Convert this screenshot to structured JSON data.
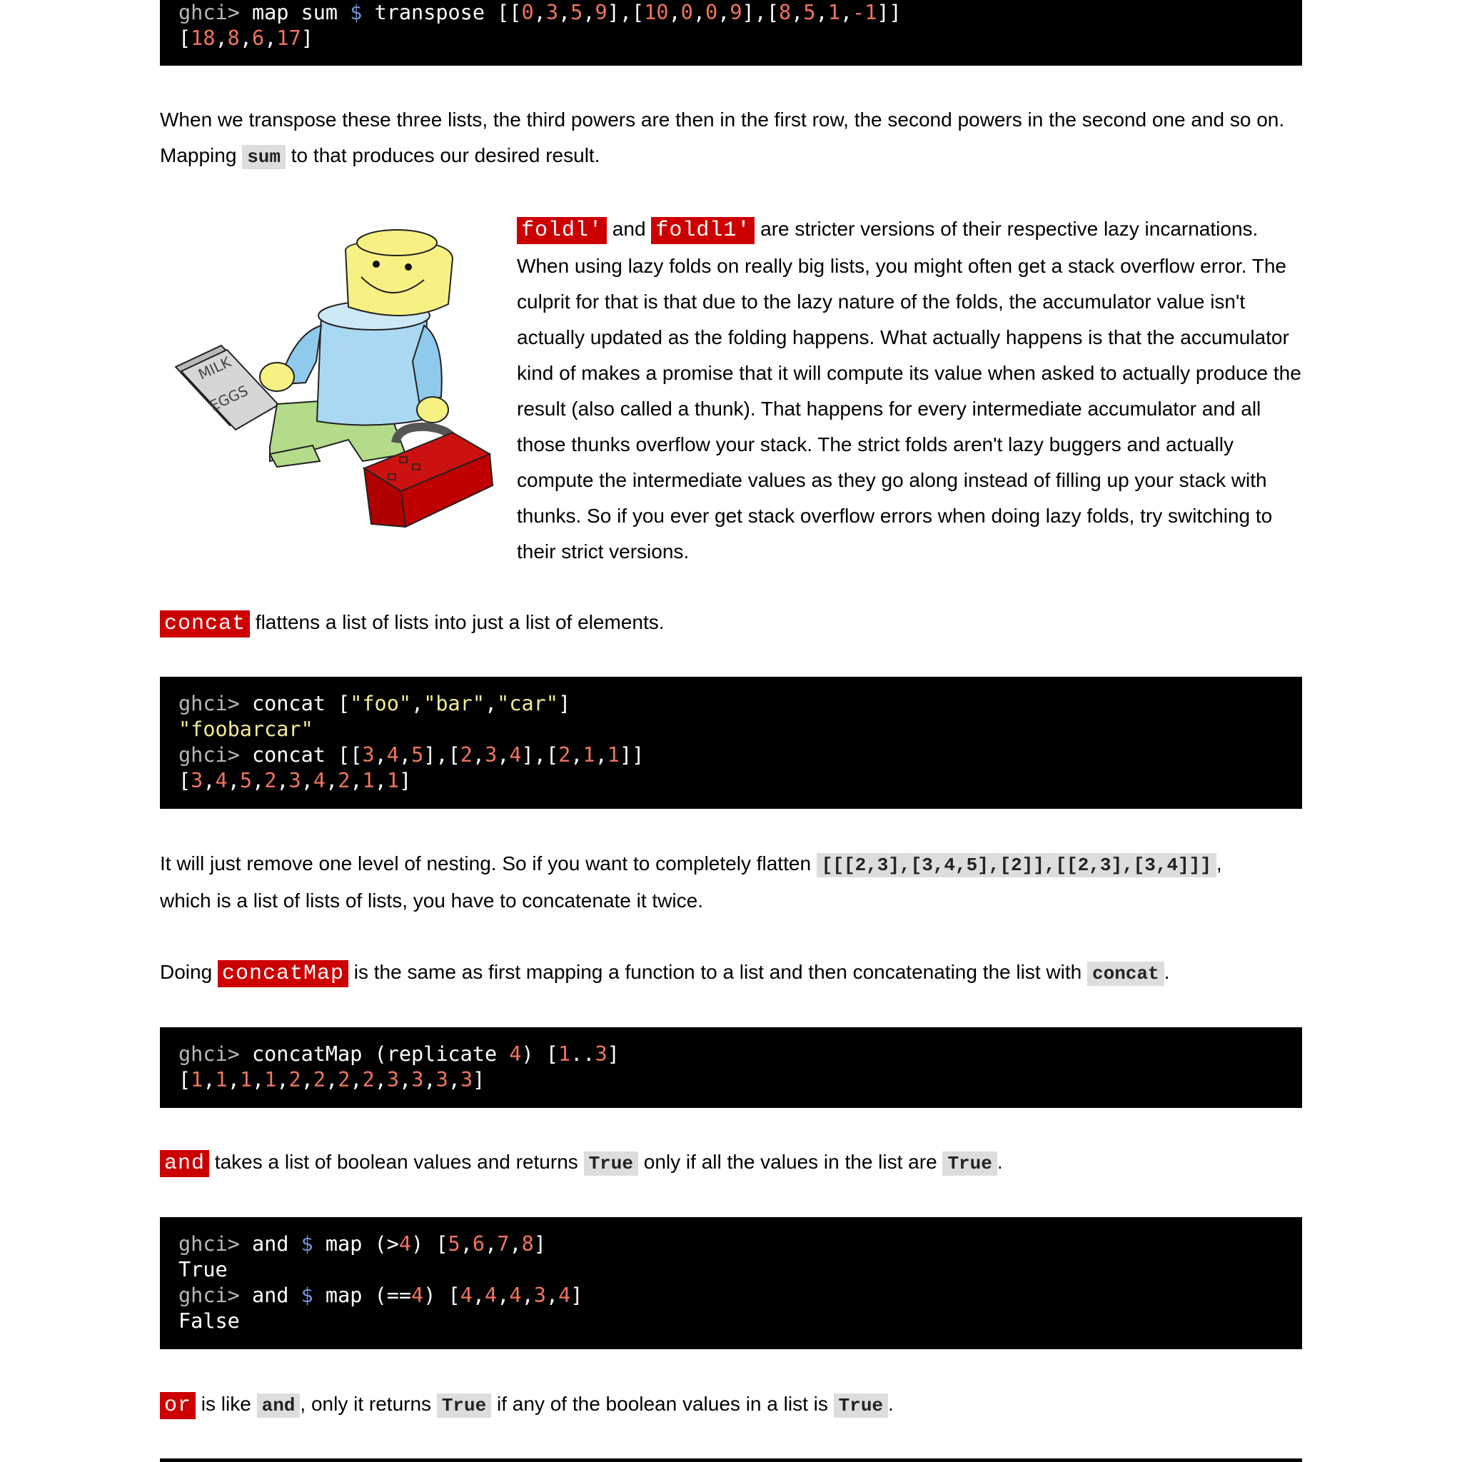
{
  "code_block_1": {
    "lines": [
      [
        {
          "c": "pr",
          "t": "ghci> "
        },
        {
          "c": "",
          "t": "map sum "
        },
        {
          "c": "op",
          "t": "$"
        },
        {
          "c": "",
          "t": " transpose [["
        },
        {
          "c": "n",
          "t": "0"
        },
        {
          "c": "",
          "t": ","
        },
        {
          "c": "n",
          "t": "3"
        },
        {
          "c": "",
          "t": ","
        },
        {
          "c": "n",
          "t": "5"
        },
        {
          "c": "",
          "t": ","
        },
        {
          "c": "n",
          "t": "9"
        },
        {
          "c": "",
          "t": "],["
        },
        {
          "c": "n",
          "t": "10"
        },
        {
          "c": "",
          "t": ","
        },
        {
          "c": "n",
          "t": "0"
        },
        {
          "c": "",
          "t": ","
        },
        {
          "c": "n",
          "t": "0"
        },
        {
          "c": "",
          "t": ","
        },
        {
          "c": "n",
          "t": "9"
        },
        {
          "c": "",
          "t": "],["
        },
        {
          "c": "n",
          "t": "8"
        },
        {
          "c": "",
          "t": ","
        },
        {
          "c": "n",
          "t": "5"
        },
        {
          "c": "",
          "t": ","
        },
        {
          "c": "n",
          "t": "1"
        },
        {
          "c": "",
          "t": ","
        },
        {
          "c": "n",
          "t": "-1"
        },
        {
          "c": "",
          "t": "]]"
        }
      ],
      [
        {
          "c": "",
          "t": "["
        },
        {
          "c": "n",
          "t": "18"
        },
        {
          "c": "",
          "t": ","
        },
        {
          "c": "n",
          "t": "8"
        },
        {
          "c": "",
          "t": ","
        },
        {
          "c": "n",
          "t": "6"
        },
        {
          "c": "",
          "t": ","
        },
        {
          "c": "n",
          "t": "17"
        },
        {
          "c": "",
          "t": "]"
        }
      ]
    ]
  },
  "para_transpose": {
    "line1": "When we transpose these three lists, the third powers are then in the first row, the second powers in the second one and so on.",
    "line2_pre": "Mapping ",
    "line2_code": "sum",
    "line2_post": " to that produces our desired result."
  },
  "foldl_section": {
    "fn1": "foldl'",
    "and_text": " and ",
    "fn2": "foldl1'",
    "lines": [
      " are stricter versions of their respective lazy incarnations.",
      "When using lazy folds on really big lists, you might often get a stack overflow error. The",
      "culprit for that is that due to the lazy nature of the folds, the accumulator value isn't",
      "actually updated as the folding happens. What actually happens is that the accumulator",
      "kind of makes a promise that it will compute its value when asked to actually produce the",
      "result (also called a thunk). That happens for every intermediate accumulator and all",
      "those thunks overflow your stack. The strict folds aren't lazy buggers and actually",
      "compute the intermediate values as they go along instead of filling up your stack with",
      "thunks. So if you ever get stack overflow errors when doing lazy folds, try switching to",
      "their strict versions."
    ],
    "illustration": {
      "icon": "lego-man-with-toolbox-icon",
      "note_text_1": "MILK",
      "note_text_2": "EGGS"
    }
  },
  "para_concat": {
    "fn": "concat",
    "text": " flattens a list of lists into just a list of elements."
  },
  "code_block_2": {
    "lines": [
      [
        {
          "c": "pr",
          "t": "ghci> "
        },
        {
          "c": "",
          "t": "concat ["
        },
        {
          "c": "s",
          "t": "\"foo\""
        },
        {
          "c": "",
          "t": ","
        },
        {
          "c": "s",
          "t": "\"bar\""
        },
        {
          "c": "",
          "t": ","
        },
        {
          "c": "s",
          "t": "\"car\""
        },
        {
          "c": "",
          "t": "]"
        }
      ],
      [
        {
          "c": "s",
          "t": "\"foobarcar\""
        }
      ],
      [
        {
          "c": "pr",
          "t": "ghci> "
        },
        {
          "c": "",
          "t": "concat [["
        },
        {
          "c": "n",
          "t": "3"
        },
        {
          "c": "",
          "t": ","
        },
        {
          "c": "n",
          "t": "4"
        },
        {
          "c": "",
          "t": ","
        },
        {
          "c": "n",
          "t": "5"
        },
        {
          "c": "",
          "t": "],["
        },
        {
          "c": "n",
          "t": "2"
        },
        {
          "c": "",
          "t": ","
        },
        {
          "c": "n",
          "t": "3"
        },
        {
          "c": "",
          "t": ","
        },
        {
          "c": "n",
          "t": "4"
        },
        {
          "c": "",
          "t": "],["
        },
        {
          "c": "n",
          "t": "2"
        },
        {
          "c": "",
          "t": ","
        },
        {
          "c": "n",
          "t": "1"
        },
        {
          "c": "",
          "t": ","
        },
        {
          "c": "n",
          "t": "1"
        },
        {
          "c": "",
          "t": "]]"
        }
      ],
      [
        {
          "c": "",
          "t": "["
        },
        {
          "c": "n",
          "t": "3"
        },
        {
          "c": "",
          "t": ","
        },
        {
          "c": "n",
          "t": "4"
        },
        {
          "c": "",
          "t": ","
        },
        {
          "c": "n",
          "t": "5"
        },
        {
          "c": "",
          "t": ","
        },
        {
          "c": "n",
          "t": "2"
        },
        {
          "c": "",
          "t": ","
        },
        {
          "c": "n",
          "t": "3"
        },
        {
          "c": "",
          "t": ","
        },
        {
          "c": "n",
          "t": "4"
        },
        {
          "c": "",
          "t": ","
        },
        {
          "c": "n",
          "t": "2"
        },
        {
          "c": "",
          "t": ","
        },
        {
          "c": "n",
          "t": "1"
        },
        {
          "c": "",
          "t": ","
        },
        {
          "c": "n",
          "t": "1"
        },
        {
          "c": "",
          "t": "]"
        }
      ]
    ]
  },
  "para_nesting": {
    "line1_pre": "It will just remove one level of nesting. So if you want to completely flatten ",
    "line1_code": "[[[2,3],[3,4,5],[2]],[[2,3],[3,4]]]",
    "line1_post": ",",
    "line2": "which is a list of lists of lists, you have to concatenate it twice."
  },
  "para_concatmap": {
    "pre": "Doing ",
    "fn": "concatMap",
    "mid": " is the same as first mapping a function to a list and then concatenating the list with ",
    "code": "concat",
    "post": "."
  },
  "code_block_3": {
    "lines": [
      [
        {
          "c": "pr",
          "t": "ghci> "
        },
        {
          "c": "",
          "t": "concatMap (replicate "
        },
        {
          "c": "n",
          "t": "4"
        },
        {
          "c": "",
          "t": ") ["
        },
        {
          "c": "n",
          "t": "1"
        },
        {
          "c": "",
          "t": ".."
        },
        {
          "c": "n",
          "t": "3"
        },
        {
          "c": "",
          "t": "]"
        }
      ],
      [
        {
          "c": "",
          "t": "["
        },
        {
          "c": "n",
          "t": "1"
        },
        {
          "c": "",
          "t": ","
        },
        {
          "c": "n",
          "t": "1"
        },
        {
          "c": "",
          "t": ","
        },
        {
          "c": "n",
          "t": "1"
        },
        {
          "c": "",
          "t": ","
        },
        {
          "c": "n",
          "t": "1"
        },
        {
          "c": "",
          "t": ","
        },
        {
          "c": "n",
          "t": "2"
        },
        {
          "c": "",
          "t": ","
        },
        {
          "c": "n",
          "t": "2"
        },
        {
          "c": "",
          "t": ","
        },
        {
          "c": "n",
          "t": "2"
        },
        {
          "c": "",
          "t": ","
        },
        {
          "c": "n",
          "t": "2"
        },
        {
          "c": "",
          "t": ","
        },
        {
          "c": "n",
          "t": "3"
        },
        {
          "c": "",
          "t": ","
        },
        {
          "c": "n",
          "t": "3"
        },
        {
          "c": "",
          "t": ","
        },
        {
          "c": "n",
          "t": "3"
        },
        {
          "c": "",
          "t": ","
        },
        {
          "c": "n",
          "t": "3"
        },
        {
          "c": "",
          "t": "]"
        }
      ]
    ]
  },
  "para_and": {
    "fn": "and",
    "t1": " takes a list of boolean values and returns ",
    "code1": "True",
    "t2": " only if all the values in the list are ",
    "code2": "True",
    "t3": "."
  },
  "code_block_4": {
    "lines": [
      [
        {
          "c": "pr",
          "t": "ghci> "
        },
        {
          "c": "",
          "t": "and "
        },
        {
          "c": "op",
          "t": "$"
        },
        {
          "c": "",
          "t": " map (>"
        },
        {
          "c": "n",
          "t": "4"
        },
        {
          "c": "",
          "t": ") ["
        },
        {
          "c": "n",
          "t": "5"
        },
        {
          "c": "",
          "t": ","
        },
        {
          "c": "n",
          "t": "6"
        },
        {
          "c": "",
          "t": ","
        },
        {
          "c": "n",
          "t": "7"
        },
        {
          "c": "",
          "t": ","
        },
        {
          "c": "n",
          "t": "8"
        },
        {
          "c": "",
          "t": "]"
        }
      ],
      [
        {
          "c": "",
          "t": "True"
        }
      ],
      [
        {
          "c": "pr",
          "t": "ghci> "
        },
        {
          "c": "",
          "t": "and "
        },
        {
          "c": "op",
          "t": "$"
        },
        {
          "c": "",
          "t": " map (=="
        },
        {
          "c": "n",
          "t": "4"
        },
        {
          "c": "",
          "t": ") ["
        },
        {
          "c": "n",
          "t": "4"
        },
        {
          "c": "",
          "t": ","
        },
        {
          "c": "n",
          "t": "4"
        },
        {
          "c": "",
          "t": ","
        },
        {
          "c": "n",
          "t": "4"
        },
        {
          "c": "",
          "t": ","
        },
        {
          "c": "n",
          "t": "3"
        },
        {
          "c": "",
          "t": ","
        },
        {
          "c": "n",
          "t": "4"
        },
        {
          "c": "",
          "t": "]"
        }
      ],
      [
        {
          "c": "",
          "t": "False"
        }
      ]
    ]
  },
  "para_or": {
    "fn": "or",
    "t1": " is like ",
    "code1": "and",
    "t2": ", only it returns ",
    "code2": "True",
    "t3": " if any of the boolean values in a list is ",
    "code3": "True",
    "t4": "."
  }
}
